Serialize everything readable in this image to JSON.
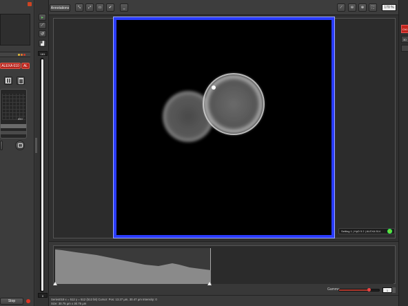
{
  "left_panel": {
    "laser_label": "ALEXA 610",
    "laser_label_2": "AL",
    "axis_value": "850",
    "stop_label": "Stop"
  },
  "side_toolbar": {
    "counter": "161",
    "bottom_value": "0"
  },
  "top_toolbar": {
    "annotations_label": "Annotations",
    "zoom_value": "170 %"
  },
  "viewer": {
    "status_text": "Setting 1 | HyD 5 2 | ALEXA 514",
    "status_dot_color": "#7ad13a",
    "frame_color": "#2a3cff"
  },
  "right_tabs": [
    {
      "label": "Ch1",
      "active": true
    },
    {
      "label": "3D",
      "active": false
    },
    {
      "label": "",
      "active": false
    }
  ],
  "histogram": {
    "gamma_label": "Gamma",
    "gamma_value": "1",
    "gamma_level": 0.72
  },
  "status_bar": {
    "line1": "Series019   x = 512  y = 512  (512 bit)   Cursor:  Pos: 13.27 µm, 30.47 µm   Intensity: 0",
    "line2": "Size: 30.75 µm x 30.75 µm",
    "left_button": "per"
  }
}
